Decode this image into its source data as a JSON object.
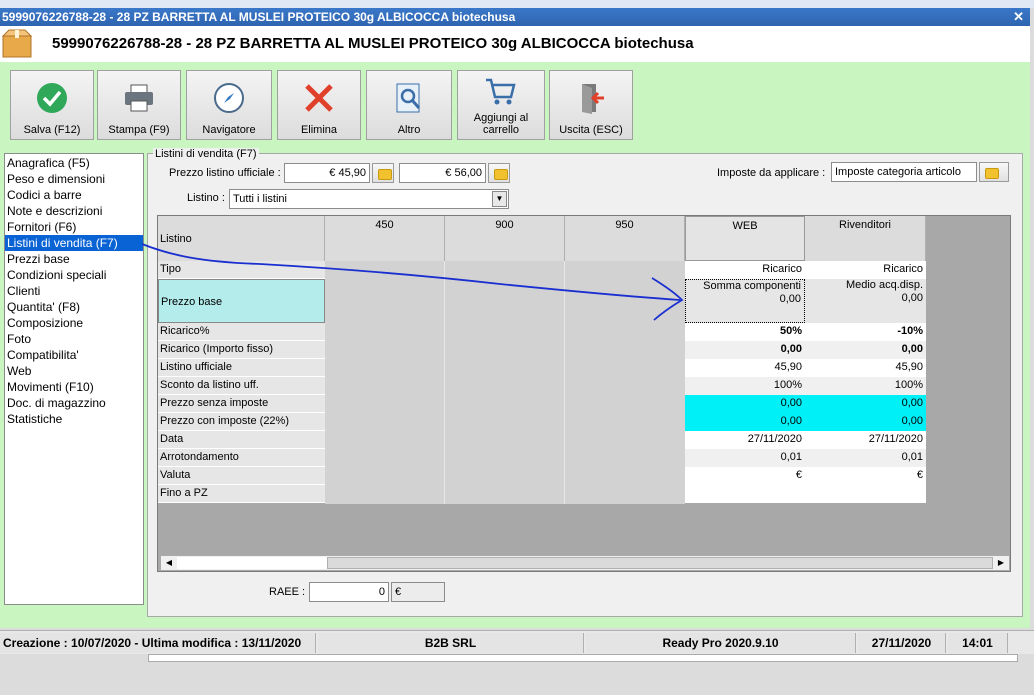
{
  "window": {
    "title": "5999076226788-28 - 28 PZ BARRETTA AL MUSLEI PROTEICO  30g ALBICOCCA biotechusa",
    "header_title": "5999076226788-28 - 28 PZ BARRETTA AL MUSLEI PROTEICO  30g ALBICOCCA biotechusa"
  },
  "toolbar": {
    "save": "Salva (F12)",
    "print": "Stampa (F9)",
    "navigator": "Navigatore",
    "delete": "Elimina",
    "other": "Altro",
    "add_cart": "Aggiungi al carrello",
    "exit": "Uscita (ESC)"
  },
  "sidebar": {
    "items": [
      {
        "label": "Anagrafica (F5)"
      },
      {
        "label": "Peso e dimensioni"
      },
      {
        "label": "Codici a barre"
      },
      {
        "label": "Note e descrizioni"
      },
      {
        "label": "Fornitori (F6)"
      },
      {
        "label": "Listini di vendita (F7)"
      },
      {
        "label": "Prezzi base"
      },
      {
        "label": "Condizioni speciali"
      },
      {
        "label": "Clienti"
      },
      {
        "label": "Quantita' (F8)"
      },
      {
        "label": "Composizione"
      },
      {
        "label": "Foto"
      },
      {
        "label": "Compatibilita'"
      },
      {
        "label": "Web"
      },
      {
        "label": "Movimenti (F10)"
      },
      {
        "label": "Doc. di magazzino"
      },
      {
        "label": "Statistiche"
      }
    ],
    "selected": "Listini di vendita (F7)"
  },
  "panel": {
    "group_label": "Listini di vendita (F7)",
    "official_price_label": "Prezzo listino ufficiale :",
    "official_price_1": "€ 45,90",
    "official_price_2": "€ 56,00",
    "taxes_label": "Imposte da applicare :",
    "taxes_value": "Imposte categoria articolo",
    "listino_label": "Listino :",
    "listino_value": "Tutti i listini"
  },
  "grid": {
    "columns": [
      "450",
      "900",
      "950",
      "WEB",
      "Rivenditori"
    ],
    "first_header": "Listino",
    "row_labels": [
      "Tipo",
      "Prezzo base",
      "Ricarico%",
      "Ricarico (Importo fisso)",
      "Listino ufficiale",
      "Sconto da listino uff.",
      "Prezzo senza imposte",
      "Prezzo con imposte (22%)",
      "Data",
      "Arrotondamento",
      "Valuta",
      "Fino a PZ"
    ],
    "web": {
      "tipo": "Ricarico",
      "prezzo_base_line1": "Somma componenti",
      "prezzo_base_line2": "0,00",
      "ricarico_pct": "50%",
      "ricarico_fisso": "0,00",
      "listino_uff": "45,90",
      "sconto": "100%",
      "prezzo_senza": "0,00",
      "prezzo_con": "0,00",
      "data": "27/11/2020",
      "arrotondamento": "0,01",
      "valuta": "€",
      "fino_a": ""
    },
    "rivenditori": {
      "tipo": "Ricarico",
      "prezzo_base_line1": "Medio acq.disp.",
      "prezzo_base_line2": "0,00",
      "ricarico_pct": "-10%",
      "ricarico_fisso": "0,00",
      "listino_uff": "45,90",
      "sconto": "100%",
      "prezzo_senza": "0,00",
      "prezzo_con": "0,00",
      "data": "27/11/2020",
      "arrotondamento": "0,01",
      "valuta": "€",
      "fino_a": ""
    }
  },
  "raee": {
    "label": "RAEE :",
    "value": "0",
    "currency": "€"
  },
  "statusbar": {
    "dates": "Creazione : 10/07/2020 - Ultima modifica : 13/11/2020",
    "company": "B2B SRL",
    "version": "Ready Pro 2020.9.10",
    "date": "27/11/2020",
    "time": "14:01"
  },
  "colors": {
    "accent_green": "#c8f5c0",
    "selection_blue": "#0a63d4",
    "highlight_cyan": "#00f0f8",
    "prezzo_base_cell": "#b4ecec",
    "annotation_ink": "#1a2fd0"
  }
}
